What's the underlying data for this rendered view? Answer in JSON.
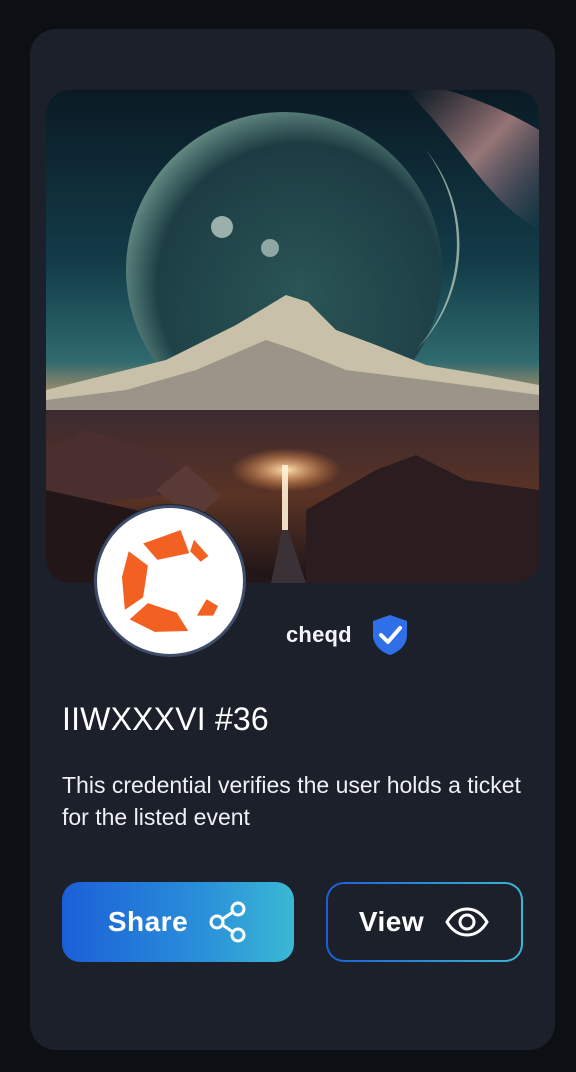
{
  "credential": {
    "issuer_name": "cheqd",
    "title": "IIWXXXVI #36",
    "description": "This credential verifies the user holds a ticket for the listed event"
  },
  "buttons": {
    "share_label": "Share",
    "view_label": "View"
  },
  "icons": {
    "issuer_logo": "cheqd-logo",
    "verified": "verified-shield-icon",
    "share": "share-icon",
    "view": "eye-icon"
  },
  "colors": {
    "accent_blue": "#1b5fd8",
    "accent_cyan": "#3ab8d4",
    "logo_orange": "#f26122",
    "verified_blue": "#2f6fe8",
    "card_bg": "#1c202a"
  }
}
